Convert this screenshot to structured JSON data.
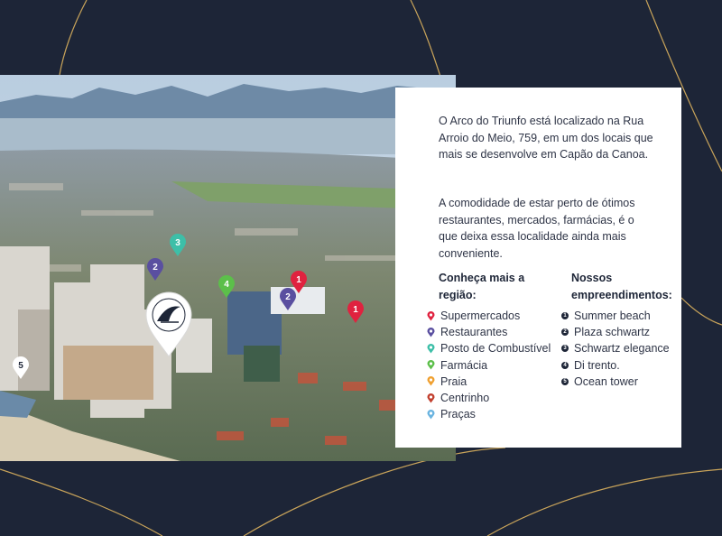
{
  "intro_paragraph": "O Arco do Triunfo está localizado na Rua Arroio do Meio, 759, em um dos locais que mais se desenvolve em Capão da Canoa.",
  "convenience_paragraph": "A comodidade de estar perto de ótimos restaurantes, mercados, farmácias, é o que deixa essa localidade ainda mais conveniente.",
  "region_title": "Conheça mais a região:",
  "developments_title": "Nossos empreendimentos:",
  "region_items": [
    {
      "label": "Supermercados",
      "color": "#e0223f",
      "icon": "map-pin-icon"
    },
    {
      "label": "Restaurantes",
      "color": "#5a4fa0",
      "icon": "map-pin-icon"
    },
    {
      "label": "Posto de Combustível",
      "color": "#3dbfa8",
      "icon": "map-pin-icon"
    },
    {
      "label": "Farmácia",
      "color": "#5cbf4a",
      "icon": "map-pin-icon"
    },
    {
      "label": "Praia",
      "color": "#f0a030",
      "icon": "map-pin-icon"
    },
    {
      "label": "Centrinho",
      "color": "#c2402f",
      "icon": "map-pin-icon"
    },
    {
      "label": "Praças",
      "color": "#6ab4e0",
      "icon": "map-pin-icon"
    }
  ],
  "developments": [
    {
      "number": "1",
      "label": "Summer beach"
    },
    {
      "number": "2",
      "label": "Plaza schwartz"
    },
    {
      "number": "3",
      "label": "Schwartz elegance"
    },
    {
      "number": "4",
      "label": "Di trento."
    },
    {
      "number": "5",
      "label": "Ocean tower"
    }
  ],
  "map_pins": [
    {
      "number": "3",
      "color": "#3dbfa8"
    },
    {
      "number": "2",
      "color": "#5a4fa0"
    },
    {
      "number": "4",
      "color": "#5cbf4a"
    },
    {
      "number": "1",
      "color": "#e0223f"
    },
    {
      "number": "2",
      "color": "#5a4fa0"
    },
    {
      "number": "1",
      "color": "#e0223f"
    },
    {
      "number": "5",
      "color": "#ffffff"
    }
  ],
  "colors": {
    "background": "#1d2537",
    "gold_line": "#c9a45a",
    "card": "#ffffff",
    "text": "#2e3446"
  }
}
